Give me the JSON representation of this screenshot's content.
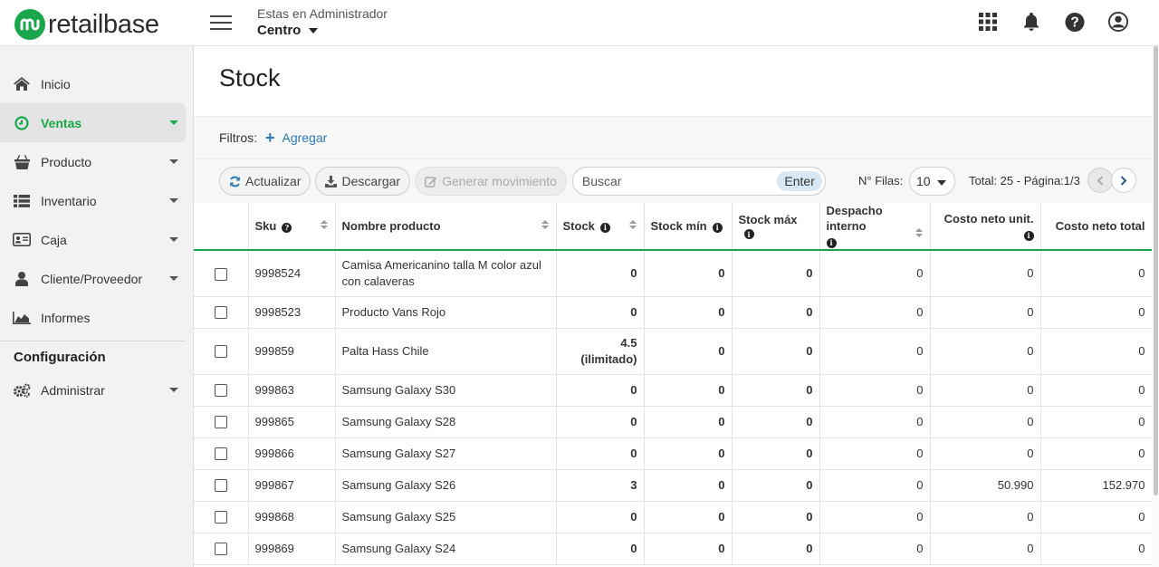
{
  "app": {
    "logo_text": "retailbase"
  },
  "header": {
    "context_label": "Estas en Administrador",
    "branch": "Centro"
  },
  "sidebar": {
    "items": [
      {
        "label": "Inicio",
        "icon": "home-icon"
      },
      {
        "label": "Ventas",
        "icon": "clock-icon"
      },
      {
        "label": "Producto",
        "icon": "basket-icon"
      },
      {
        "label": "Inventario",
        "icon": "list-icon"
      },
      {
        "label": "Caja",
        "icon": "id-card-icon"
      },
      {
        "label": "Cliente/Proveedor",
        "icon": "user-icon"
      },
      {
        "label": "Informes",
        "icon": "area-chart-icon"
      }
    ],
    "config_title": "Configuración",
    "config_item": {
      "label": "Administrar",
      "icon": "gears-icon"
    }
  },
  "page": {
    "title": "Stock"
  },
  "filters": {
    "label": "Filtros:",
    "add_label": "Agregar"
  },
  "toolbar": {
    "refresh_label": "Actualizar",
    "download_label": "Descargar",
    "generate_label": "Generar movimiento",
    "search_placeholder": "Buscar",
    "enter_label": "Enter",
    "rows_label": "N° Filas:",
    "rows_value": "10",
    "page_info": "Total: 25 - Página:1/3"
  },
  "table": {
    "headers": {
      "sku": "Sku",
      "name": "Nombre producto",
      "stock": "Stock",
      "stock_min": "Stock mín",
      "stock_max": "Stock máx",
      "despacho": "Despacho interno",
      "costo_unit": "Costo neto unit.",
      "costo_total": "Costo neto total"
    },
    "rows": [
      {
        "sku": "9998524",
        "name": "Camisa Americanino talla M color azul con calaveras",
        "stock": "0",
        "stock_min": "0",
        "stock_max": "0",
        "despacho": "0",
        "costo_unit": "0",
        "costo_total": "0"
      },
      {
        "sku": "9998523",
        "name": "Producto Vans Rojo",
        "stock": "0",
        "stock_min": "0",
        "stock_max": "0",
        "despacho": "0",
        "costo_unit": "0",
        "costo_total": "0"
      },
      {
        "sku": "999859",
        "name": "Palta Hass Chile",
        "stock": "4.5",
        "stock_note": "(ilimitado)",
        "stock_min": "0",
        "stock_max": "0",
        "despacho": "0",
        "costo_unit": "0",
        "costo_total": "0"
      },
      {
        "sku": "999863",
        "name": "Samsung Galaxy S30",
        "stock": "0",
        "stock_min": "0",
        "stock_max": "0",
        "despacho": "0",
        "costo_unit": "0",
        "costo_total": "0"
      },
      {
        "sku": "999865",
        "name": "Samsung Galaxy S28",
        "stock": "0",
        "stock_min": "0",
        "stock_max": "0",
        "despacho": "0",
        "costo_unit": "0",
        "costo_total": "0"
      },
      {
        "sku": "999866",
        "name": "Samsung Galaxy S27",
        "stock": "0",
        "stock_min": "0",
        "stock_max": "0",
        "despacho": "0",
        "costo_unit": "0",
        "costo_total": "0"
      },
      {
        "sku": "999867",
        "name": "Samsung Galaxy S26",
        "stock": "3",
        "stock_min": "0",
        "stock_max": "0",
        "despacho": "0",
        "costo_unit": "50.990",
        "costo_total": "152.970"
      },
      {
        "sku": "999868",
        "name": "Samsung Galaxy S25",
        "stock": "0",
        "stock_min": "0",
        "stock_max": "0",
        "despacho": "0",
        "costo_unit": "0",
        "costo_total": "0"
      },
      {
        "sku": "999869",
        "name": "Samsung Galaxy S24",
        "stock": "0",
        "stock_min": "0",
        "stock_max": "0",
        "despacho": "0",
        "costo_unit": "0",
        "costo_total": "0"
      }
    ]
  },
  "colors": {
    "brand": "#1aa64a",
    "link": "#2a7ab8",
    "sidebar_bg": "#f2f2f2"
  }
}
